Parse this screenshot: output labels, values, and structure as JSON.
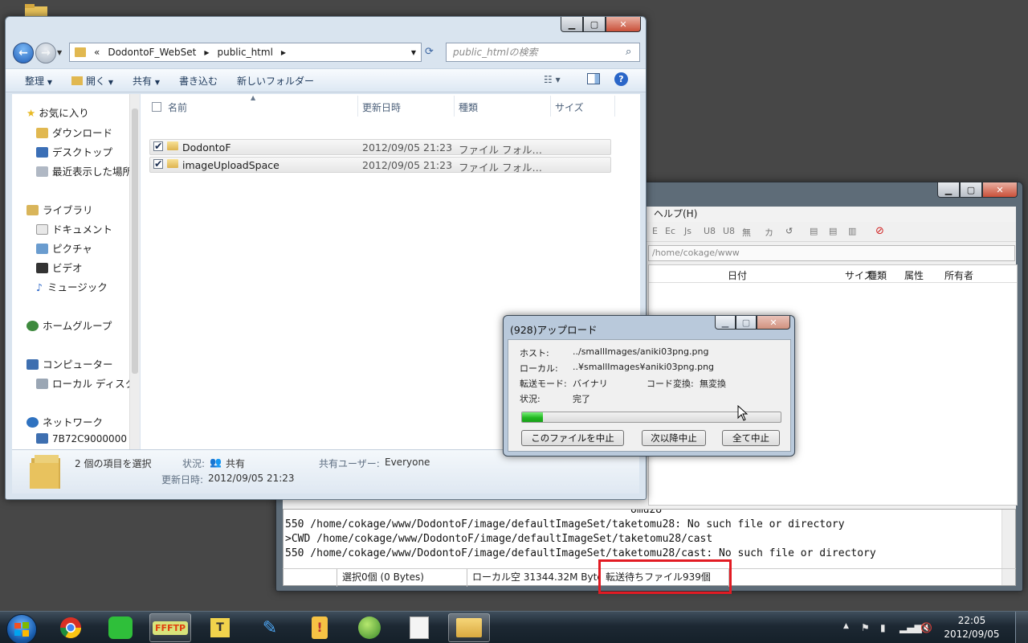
{
  "explorer": {
    "breadcrumb": {
      "prefix": "«",
      "items": [
        "DodontoF_WebSet",
        "public_html"
      ]
    },
    "search_placeholder": "public_htmlの検索",
    "toolbar": {
      "organize": "整理",
      "open": "開く",
      "share": "共有",
      "burn": "書き込む",
      "new_folder": "新しいフォルダー"
    },
    "nav": {
      "favorites": "お気に入り",
      "downloads": "ダウンロード",
      "desktop": "デスクトップ",
      "recent": "最近表示した場所",
      "libraries": "ライブラリ",
      "documents": "ドキュメント",
      "pictures": "ピクチャ",
      "videos": "ビデオ",
      "music": "ミュージック",
      "homegroup": "ホームグループ",
      "computer": "コンピューター",
      "local_disk": "ローカル ディスク",
      "network": "ネットワーク",
      "network_pc": "7B72C9000000"
    },
    "columns": {
      "name": "名前",
      "date": "更新日時",
      "type": "種類",
      "size": "サイズ"
    },
    "files": [
      {
        "name": "DodontoF",
        "date": "2012/09/05 21:23",
        "type": "ファイル フォル…"
      },
      {
        "name": "imageUploadSpace",
        "date": "2012/09/05 21:23",
        "type": "ファイル フォル…"
      }
    ],
    "details": {
      "selection": "2 個の項目を選択",
      "state_label": "状況:",
      "state_value": "共有",
      "shared_label": "共有ユーザー:",
      "shared_value": "Everyone",
      "modified_label": "更新日時:",
      "modified_value": "2012/09/05 21:23"
    }
  },
  "ffftp": {
    "menu_help": "ヘルプ(H)",
    "toolbar_glyphs": [
      "E",
      "Ec",
      "Js",
      "U8",
      "U8",
      "無",
      "カ"
    ],
    "remote_path": "/home/cokage/www",
    "columns": {
      "date": "日付",
      "size": "サイズ",
      "type": "種類",
      "attr": "属性",
      "owner": "所有者"
    },
    "log_partial": "omu28",
    "log": [
      "550 /home/cokage/www/DodontoF/image/defaultImageSet/taketomu28: No such file or directory",
      ">CWD /home/cokage/www/DodontoF/image/defaultImageSet/taketomu28/cast",
      "550 /home/cokage/www/DodontoF/image/defaultImageSet/taketomu28/cast: No such file or directory"
    ],
    "status": {
      "selection": "選択0個 (0 Bytes)",
      "local_free": "ローカル空 31344.32M Bytes",
      "queue": "転送待ちファイル939個"
    }
  },
  "upload": {
    "title": "(928)アップロード",
    "host_label": "ホスト:",
    "host_value": "../smallImages/aniki03png.png",
    "local_label": "ローカル:",
    "local_value": "..¥smallImages¥aniki03png.png",
    "mode_label": "転送モード:",
    "mode_value": "バイナリ",
    "code_label": "コード変換:",
    "code_value": "無変換",
    "state_label": "状況:",
    "state_value": "完了",
    "progress": 0.08,
    "buttons": {
      "stop_this": "このファイルを中止",
      "stop_after": "次以降中止",
      "stop_all": "全て中止"
    }
  },
  "taskbar": {
    "ffftp_label": "FFFTP",
    "clock": {
      "time": "22:05",
      "date": "2012/09/05"
    }
  },
  "colors": {
    "highlight": "#e21b23",
    "progress": "#22b822"
  }
}
